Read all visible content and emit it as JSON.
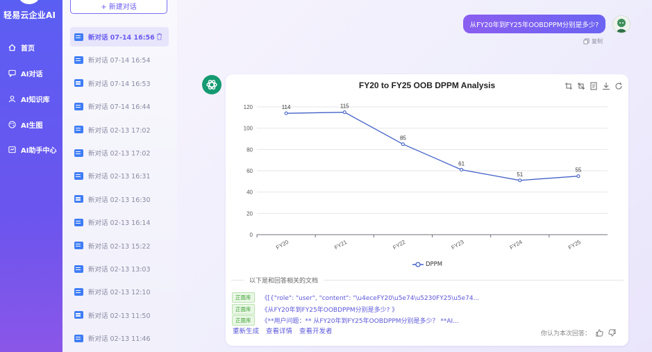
{
  "app": {
    "brand": "轻易云企业AI"
  },
  "nav": [
    {
      "label": "首页",
      "icon": "home-icon"
    },
    {
      "label": "AI对话",
      "icon": "chat-icon"
    },
    {
      "label": "AI知识库",
      "icon": "knowledge-icon"
    },
    {
      "label": "AI生图",
      "icon": "palette-icon"
    },
    {
      "label": "AI助手中心",
      "icon": "assistant-icon"
    }
  ],
  "sidebar": {
    "new_chat": "+ 新建对话",
    "conversations": [
      {
        "label": "新对话 07-14 16:56",
        "active": true
      },
      {
        "label": "新对话 07-14 16:54"
      },
      {
        "label": "新对话 07-14 16:53"
      },
      {
        "label": "新对话 07-14 16:44"
      },
      {
        "label": "新对话 02-13 17:02"
      },
      {
        "label": "新对话 02-13 17:02"
      },
      {
        "label": "新对话 02-13 16:31"
      },
      {
        "label": "新对话 02-13 16:30"
      },
      {
        "label": "新对话 02-13 16:14"
      },
      {
        "label": "新对话 02-13 15:22"
      },
      {
        "label": "新对话 02-13 13:03"
      },
      {
        "label": "新对话 02-13 12:10"
      },
      {
        "label": "新对话 02-13 11:50"
      },
      {
        "label": "新对话 02-13 11:46"
      }
    ]
  },
  "chat": {
    "question": "从FY20年到FY25年OOBDPPM分别是多少?",
    "copy_label": "复制",
    "docs_title": "以下是和回答相关的文档",
    "docs": [
      {
        "tag": "正面库",
        "text": "《[{\"role\": \"user\", \"content\": \"\\u4eceFY20\\u5e74\\u5230FY25\\u5e74..."
      },
      {
        "tag": "正面库",
        "text": "《从FY20年到FY25年OOBDPPM分别是多少? 》"
      },
      {
        "tag": "正面库",
        "text": "《**用户问题：** 从FY20年到FY25年OOBDPPM分别是多少？ **AI..."
      }
    ],
    "actions": [
      "重新生成",
      "查看详情",
      "查看开发者"
    ],
    "feedback_label": "你认为本次回答："
  },
  "chart_data": {
    "type": "line",
    "title": "FY20 to FY25 OOB DPPM Analysis",
    "categories": [
      "FY20",
      "FY21",
      "FY22",
      "FY23",
      "FY24",
      "FY25"
    ],
    "series": [
      {
        "name": "DPPM",
        "values": [
          114,
          115,
          85,
          61,
          51,
          55
        ]
      }
    ],
    "ylim": [
      0,
      120
    ],
    "yticks": [
      0,
      20,
      40,
      60,
      80,
      100,
      120
    ],
    "legend_position": "bottom",
    "color": "#4260c8"
  }
}
